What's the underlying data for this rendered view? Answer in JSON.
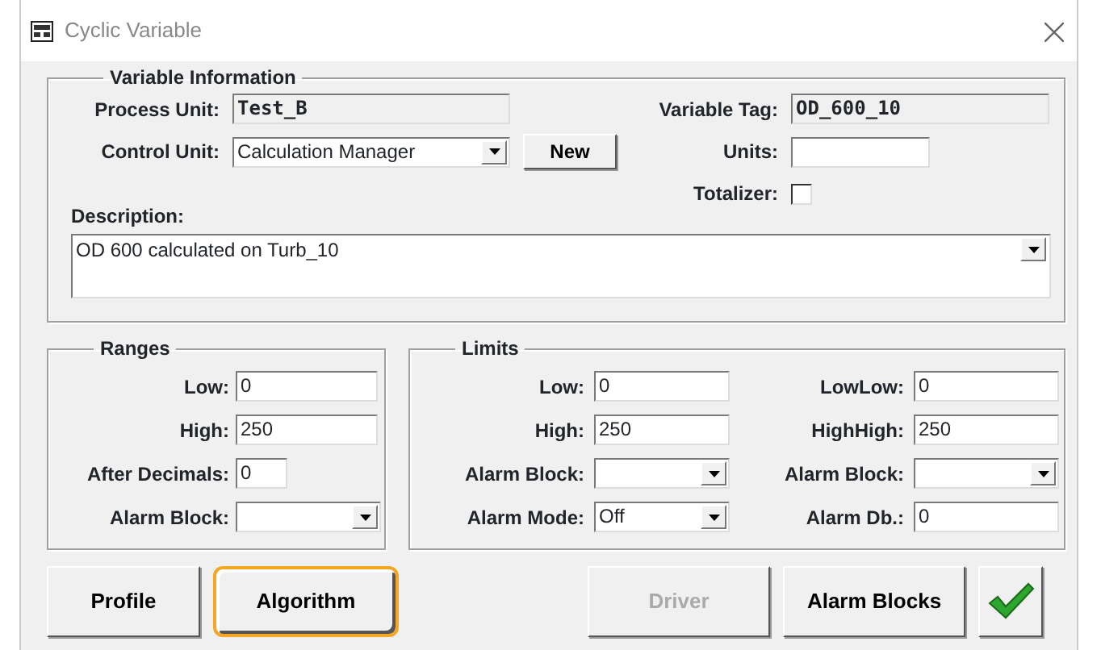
{
  "window": {
    "title": "Cyclic Variable"
  },
  "variable_information": {
    "title": "Variable Information",
    "process_unit": {
      "label": "Process Unit:",
      "value": "Test_B"
    },
    "control_unit": {
      "label": "Control Unit:",
      "value": "Calculation Manager"
    },
    "new_button": "New",
    "variable_tag": {
      "label": "Variable Tag:",
      "value": "OD_600_10"
    },
    "units": {
      "label": "Units:"
    },
    "totalizer": {
      "label": "Totalizer:",
      "checked": false
    },
    "description": {
      "label": "Description:",
      "value": "OD 600 calculated on Turb_10"
    }
  },
  "ranges": {
    "title": "Ranges",
    "fields": [
      {
        "kind": "text",
        "label": "Low:",
        "value": "0"
      },
      {
        "kind": "text",
        "label": "High:",
        "value": "250"
      },
      {
        "kind": "text",
        "label": "After Decimals:",
        "value": "0"
      },
      {
        "kind": "dropdown",
        "label": "Alarm Block:"
      }
    ]
  },
  "limits": {
    "title": "Limits",
    "left": [
      {
        "kind": "text",
        "label": "Low:",
        "value": "0"
      },
      {
        "kind": "text",
        "label": "High:",
        "value": "250"
      },
      {
        "kind": "dropdown",
        "label": "Alarm Block:"
      },
      {
        "kind": "dropdown",
        "label": "Alarm Mode:",
        "value": "Off"
      }
    ],
    "right": [
      {
        "kind": "text",
        "label": "LowLow:",
        "value": "0"
      },
      {
        "kind": "text",
        "label": "HighHigh:",
        "value": "250"
      },
      {
        "kind": "dropdown",
        "label": "Alarm Block:"
      },
      {
        "kind": "text",
        "label": "Alarm Db.:",
        "value": "0"
      }
    ]
  },
  "buttons": [
    {
      "label": "Profile",
      "disabled": false,
      "highlighted": false
    },
    {
      "label": "Algorithm",
      "disabled": false,
      "highlighted": true
    },
    {
      "label": "Driver",
      "disabled": true,
      "highlighted": false
    },
    {
      "label": "Alarm Blocks",
      "disabled": false,
      "highlighted": false
    }
  ]
}
